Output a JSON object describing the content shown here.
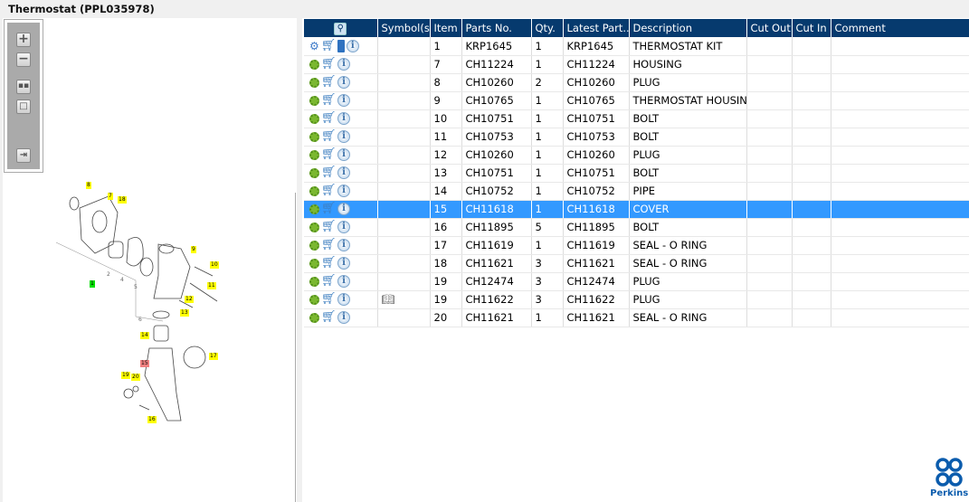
{
  "title": "Thermostat (PPL035978)",
  "toolbar": {
    "buttons": [
      "zoom-in",
      "zoom-out",
      "fit-all",
      "actual-size",
      "export"
    ]
  },
  "diagram": {
    "callouts": [
      {
        "label": "8"
      },
      {
        "label": "7"
      },
      {
        "label": "18"
      },
      {
        "label": "9"
      },
      {
        "label": "10"
      },
      {
        "label": "11"
      },
      {
        "label": "12"
      },
      {
        "label": "13"
      },
      {
        "label": "1",
        "color": "#00e000"
      },
      {
        "label": "14"
      },
      {
        "label": "17"
      },
      {
        "label": "15",
        "color": "#f08080"
      },
      {
        "label": "19"
      },
      {
        "label": "20"
      },
      {
        "label": "16"
      }
    ],
    "sub_labels": [
      "2",
      "4",
      "5",
      "6"
    ]
  },
  "table": {
    "columns": [
      "",
      "Symbol(s)",
      "Item",
      "Parts No.",
      "Qty.",
      "Latest Part...",
      "Description",
      "Cut Out",
      "Cut In",
      "Comment"
    ],
    "rows": [
      {
        "kit": true,
        "symbol": false,
        "item": "1",
        "part": "KRP1645",
        "qty": "1",
        "latest": "KRP1645",
        "desc": "THERMOSTAT KIT"
      },
      {
        "item": "7",
        "part": "CH11224",
        "qty": "1",
        "latest": "CH11224",
        "desc": "HOUSING"
      },
      {
        "item": "8",
        "part": "CH10260",
        "qty": "2",
        "latest": "CH10260",
        "desc": "PLUG"
      },
      {
        "item": "9",
        "part": "CH10765",
        "qty": "1",
        "latest": "CH10765",
        "desc": "THERMOSTAT HOUSING"
      },
      {
        "item": "10",
        "part": "CH10751",
        "qty": "1",
        "latest": "CH10751",
        "desc": "BOLT"
      },
      {
        "item": "11",
        "part": "CH10753",
        "qty": "1",
        "latest": "CH10753",
        "desc": "BOLT"
      },
      {
        "item": "12",
        "part": "CH10260",
        "qty": "1",
        "latest": "CH10260",
        "desc": "PLUG"
      },
      {
        "item": "13",
        "part": "CH10751",
        "qty": "1",
        "latest": "CH10751",
        "desc": "BOLT"
      },
      {
        "item": "14",
        "part": "CH10752",
        "qty": "1",
        "latest": "CH10752",
        "desc": "PIPE"
      },
      {
        "item": "15",
        "part": "CH11618",
        "qty": "1",
        "latest": "CH11618",
        "desc": "COVER",
        "selected": true
      },
      {
        "item": "16",
        "part": "CH11895",
        "qty": "5",
        "latest": "CH11895",
        "desc": "BOLT"
      },
      {
        "item": "17",
        "part": "CH11619",
        "qty": "1",
        "latest": "CH11619",
        "desc": "SEAL - O RING"
      },
      {
        "item": "18",
        "part": "CH11621",
        "qty": "3",
        "latest": "CH11621",
        "desc": "SEAL - O RING"
      },
      {
        "item": "19",
        "part": "CH12474",
        "qty": "3",
        "latest": "CH12474",
        "desc": "PLUG"
      },
      {
        "item": "19",
        "part": "CH11622",
        "qty": "3",
        "latest": "CH11622",
        "desc": "PLUG",
        "symbol": true
      },
      {
        "item": "20",
        "part": "CH11621",
        "qty": "1",
        "latest": "CH11621",
        "desc": "SEAL - O RING"
      }
    ]
  },
  "logo": {
    "text": "Perkins"
  },
  "colors": {
    "header": "#063a6e",
    "selected": "#3399ff",
    "callout": "#ffff00"
  }
}
